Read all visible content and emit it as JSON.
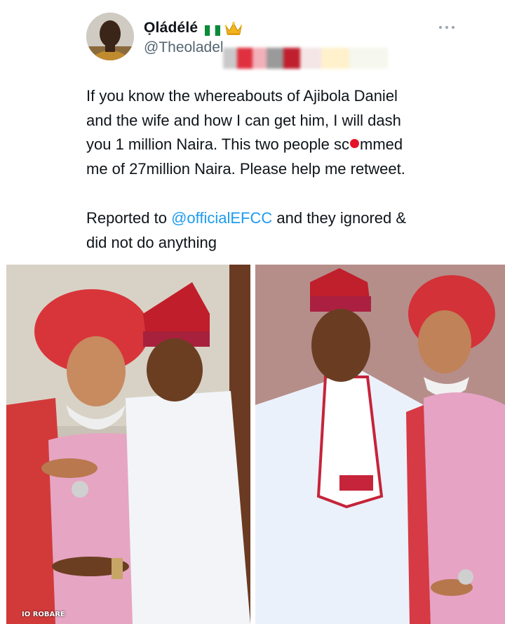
{
  "tweet": {
    "display_name": "Ọládélé",
    "handle": "@Theoladel",
    "flag_icon": "nigeria-flag-icon",
    "crown_icon": "crown-icon",
    "more_icon": "more-horizontal-icon",
    "body_part1": "If you know the whereabouts of Ajibola Daniel\nand the wife and how I can get him, I will dash\nyou 1 million Naira. This two people sc",
    "body_part2": "mmed\nme of 27million Naira. Please help me retweet.",
    "report_prefix": "Reported to ",
    "report_mention": "@officialEFCC",
    "report_suffix": " and they ignored &\ndid not do anything"
  },
  "media": {
    "watermark": "IO ROBARE"
  },
  "colors": {
    "link": "#1d9bf0",
    "secondary_text": "#536471",
    "red_dot": "#e4132a"
  }
}
